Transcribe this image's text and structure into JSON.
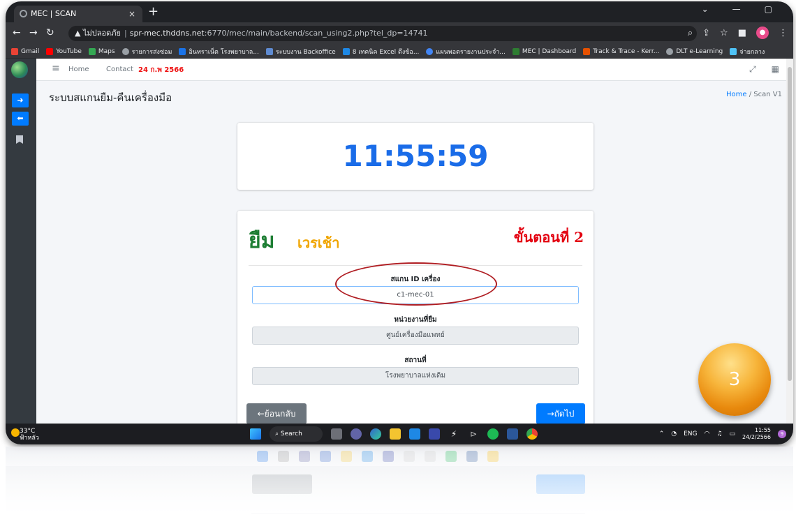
{
  "browser": {
    "tab_title": "MEC | SCAN",
    "tab_close": "×",
    "new_tab": "+",
    "address_warning": "▲ ไม่ปลอดภัย",
    "address_host": "spr-mec.thddns.net",
    "address_path": ":6770/mec/main/backend/scan_using2.php?tel_dp=14741",
    "bookmarks": [
      {
        "label": "Gmail",
        "color": "#ea4335"
      },
      {
        "label": "YouTube",
        "color": "#ff0000"
      },
      {
        "label": "Maps",
        "color": "#34a853"
      },
      {
        "label": "รายการส่งซ่อม",
        "color": "#9aa0a6"
      },
      {
        "label": "อินทราเน็ต โรงพยาบาล...",
        "color": "#1a73e8"
      },
      {
        "label": "ระบบงาน Backoffice",
        "color": "#5f8bd1"
      },
      {
        "label": "8 เทคนิค Excel ดึงข้อ...",
        "color": "#1e88e5"
      },
      {
        "label": "แผนพอตรายงานประจำ...",
        "color": "#4285f4"
      },
      {
        "label": "MEC | Dashboard",
        "color": "#2e7d32"
      },
      {
        "label": "Track & Trace - Kerr...",
        "color": "#e65100"
      },
      {
        "label": "DLT e-Learning",
        "color": "#9aa0a6"
      },
      {
        "label": "จ่ายกลาง",
        "color": "#4fc3f7"
      }
    ]
  },
  "navbar": {
    "home": "Home",
    "contact": "Contact",
    "date": "24 ก.พ 2566"
  },
  "page": {
    "title": "ระบบสแกนยืม-คืนเครื่องมือ",
    "breadcrumb_home": "Home",
    "breadcrumb_sep": "/",
    "breadcrumb_current": "Scan V1"
  },
  "clock": "11:55:59",
  "form": {
    "heading": "ยืม",
    "shift": "เวรเช้า",
    "step": "ขั้นตอนที่ 2",
    "scan_label": "สแกน ID เครื่อง",
    "scan_value": "c1-mec-01",
    "dept_label": "หน่วยงานที่ยืม",
    "dept_value": "ศูนย์เครื่องมือแพทย์",
    "place_label": "สถานที่",
    "place_value": "โรงพยาบาลแห่งเดิม",
    "back_button": "←ย้อนกลับ",
    "next_button": "→ถัดไป"
  },
  "badge": "3",
  "taskbar": {
    "temp": "33°C",
    "weather": "ฟ้าหลัว",
    "search": "Search",
    "lang": "ENG",
    "time": "11:55",
    "date": "24/2/2566",
    "notifications": "9"
  }
}
